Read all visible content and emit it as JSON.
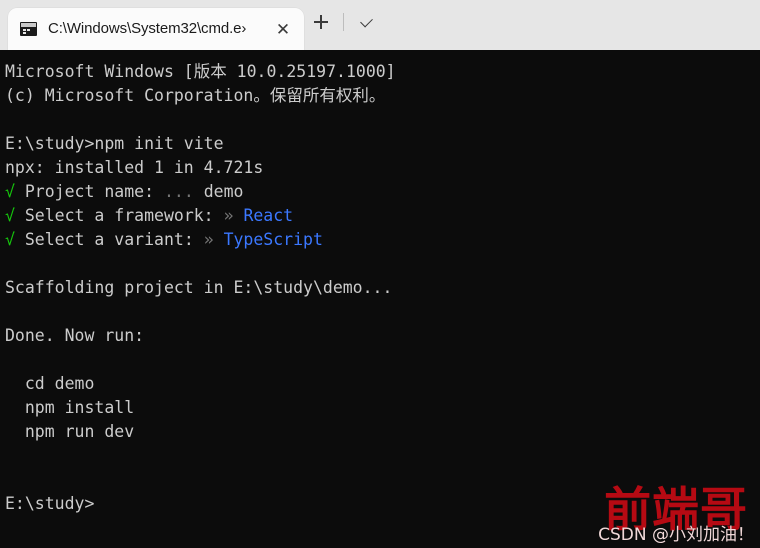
{
  "window": {
    "titlebar": {
      "tab": {
        "icon": "console-icon",
        "title": "C:\\Windows\\System32\\cmd.e›",
        "close_label": "✕"
      },
      "new_tab_label": "+",
      "dropdown_label": "⌄"
    }
  },
  "terminal": {
    "background_color": "#0c0c0c",
    "foreground_color": "#cccccc",
    "accent_green": "#16c60c",
    "accent_blue": "#3b78ff",
    "dim_color": "#767676",
    "lines": [
      {
        "id": "version",
        "segments": [
          {
            "text": "Microsoft Windows [版本 10.0.25197.1000]",
            "color": "white"
          }
        ]
      },
      {
        "id": "copyright",
        "segments": [
          {
            "text": "(c) Microsoft Corporation。保留所有权利。",
            "color": "white"
          }
        ]
      },
      {
        "id": "blank-1",
        "segments": [
          {
            "text": "",
            "color": "white"
          }
        ]
      },
      {
        "id": "cmd-init",
        "segments": [
          {
            "text": "E:\\study>npm init vite",
            "color": "white"
          }
        ]
      },
      {
        "id": "npx-line",
        "segments": [
          {
            "text": "npx: installed 1 in 4.721s",
            "color": "white"
          }
        ]
      },
      {
        "id": "project-name",
        "segments": [
          {
            "text": "√",
            "color": "green"
          },
          {
            "text": " Project name: ",
            "color": "white"
          },
          {
            "text": "...",
            "color": "dim"
          },
          {
            "text": " demo",
            "color": "white"
          }
        ]
      },
      {
        "id": "framework",
        "segments": [
          {
            "text": "√",
            "color": "green"
          },
          {
            "text": " Select a framework: ",
            "color": "white"
          },
          {
            "text": "» ",
            "color": "dim"
          },
          {
            "text": "React",
            "color": "blue"
          }
        ]
      },
      {
        "id": "variant",
        "segments": [
          {
            "text": "√",
            "color": "green"
          },
          {
            "text": " Select a variant: ",
            "color": "white"
          },
          {
            "text": "» ",
            "color": "dim"
          },
          {
            "text": "TypeScript",
            "color": "blue"
          }
        ]
      },
      {
        "id": "blank-2",
        "segments": [
          {
            "text": "",
            "color": "white"
          }
        ]
      },
      {
        "id": "scaffolding",
        "segments": [
          {
            "text": "Scaffolding project in E:\\study\\demo...",
            "color": "white"
          }
        ]
      },
      {
        "id": "blank-3",
        "segments": [
          {
            "text": "",
            "color": "white"
          }
        ]
      },
      {
        "id": "done",
        "segments": [
          {
            "text": "Done. Now run:",
            "color": "white"
          }
        ]
      },
      {
        "id": "blank-4",
        "segments": [
          {
            "text": "",
            "color": "white"
          }
        ]
      },
      {
        "id": "cmd-cd",
        "segments": [
          {
            "text": "  cd demo",
            "color": "white"
          }
        ]
      },
      {
        "id": "cmd-install",
        "segments": [
          {
            "text": "  npm install",
            "color": "white"
          }
        ]
      },
      {
        "id": "cmd-rundev",
        "segments": [
          {
            "text": "  npm run dev",
            "color": "white"
          }
        ]
      },
      {
        "id": "blank-5",
        "segments": [
          {
            "text": "",
            "color": "white"
          }
        ]
      },
      {
        "id": "blank-6",
        "segments": [
          {
            "text": "",
            "color": "white"
          }
        ]
      },
      {
        "id": "prompt",
        "segments": [
          {
            "text": "E:\\study>",
            "color": "white"
          }
        ]
      }
    ]
  },
  "watermark": {
    "main_text": "前端哥",
    "sub_text": "CSDN @小刘加油！",
    "main_color": "#b60a13",
    "sub_color": "#f0d8d8"
  }
}
